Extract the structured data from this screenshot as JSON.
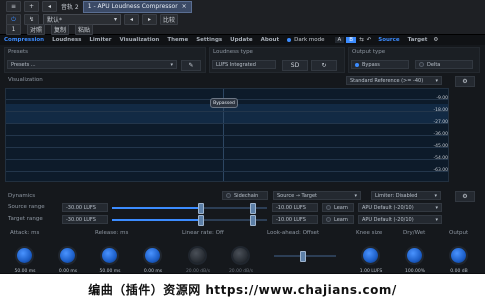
{
  "host": {
    "track": "音轨 2",
    "track_number": "1",
    "plugin_title": "1 - APU Loudness Compressor",
    "preset_value": "默认*",
    "compare": "比较",
    "copy_short": "对照",
    "paste_label": "复制",
    "paste2": "粘贴"
  },
  "plugin": {
    "tabs": [
      "Compression",
      "Loudness",
      "Limiter",
      "Visualization",
      "Theme",
      "Settings",
      "Update",
      "About"
    ],
    "dark_mode": "Dark mode",
    "ab": [
      "A",
      "B"
    ],
    "right_tabs": [
      "Source",
      "Target"
    ],
    "presets": {
      "title": "Presets",
      "value": "Presets ..."
    },
    "loudness_type": {
      "title": "Loudness type",
      "value": "LUFS Integrated",
      "button": "SD"
    },
    "output_type": {
      "title": "Output type",
      "opt1": "Bypass",
      "opt2": "Delta"
    },
    "viz": {
      "title": "Visualization",
      "reference": "Standard Reference (>= -40)",
      "bypassed": "Bypassed",
      "levels": [
        "-9.00",
        "-18.00",
        "-27.00",
        "-36.00",
        "-45.00",
        "-54.00",
        "-63.00"
      ]
    },
    "dynamics": {
      "title": "Dynamics",
      "sidechain": "Sidechain",
      "source_target": "Source → Target",
      "limiter": "Limiter: Disabled",
      "source_label": "Source range",
      "source_min": "-30.00 LUFS",
      "source_max": "-10.00 LUFS",
      "target_label": "Target range",
      "target_min": "-30.00 LUFS",
      "target_max": "-10.00 LUFS",
      "learn": "Learn",
      "apu_default1": "APU Default (-20/10)",
      "apu_default2": "APU Default (-20/10)"
    },
    "knobs": {
      "attack": "Attack: ms",
      "release": "Release: ms",
      "linear": "Linear rate: Off",
      "lookahead": "Look-ahead: Offset",
      "knee": "Knee size",
      "drywet": "Dry/Wet",
      "output": "Output",
      "values": [
        "50.00 ms",
        "0.00 ms",
        "50.00 ms",
        "0.00 ms",
        "20.00 dB/s",
        "20.00 dB/s",
        "1.00 LUFS",
        "100.00%",
        "0.00 dB"
      ]
    }
  },
  "footer": "编曲（插件）资源网  https://www.chajians.com/",
  "colors": {
    "accent": "#3c8cff",
    "background": "#15181c"
  }
}
